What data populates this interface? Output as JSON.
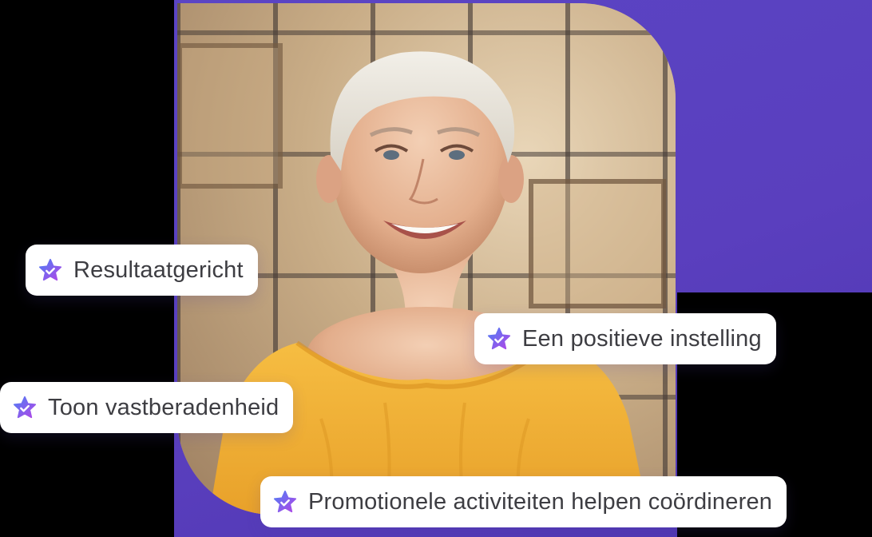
{
  "colors": {
    "accent_purple": "#5a3fbe",
    "chip_background": "#ffffff",
    "chip_text": "#3d3d42",
    "star_gradient_start": "#4f7df5",
    "star_gradient_end": "#b146e6",
    "shirt_yellow": "#f2b233"
  },
  "photo": {
    "subject": "smiling-woman-portrait"
  },
  "chips": [
    {
      "label": "Resultaatgericht",
      "icon": "star-check-icon"
    },
    {
      "label": "Een positieve instelling",
      "icon": "star-check-icon"
    },
    {
      "label": "Toon vastberadenheid",
      "icon": "star-check-icon"
    },
    {
      "label": "Promotionele activiteiten helpen coördineren",
      "icon": "star-check-icon"
    }
  ]
}
